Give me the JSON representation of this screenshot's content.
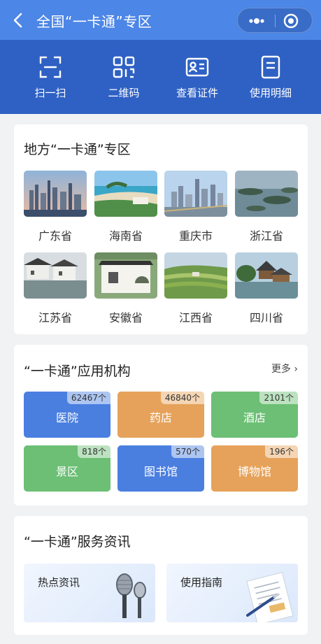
{
  "header": {
    "title": "全国“一卡通”专区"
  },
  "toolbar": {
    "items": [
      {
        "label": "扫一扫",
        "icon": "scan-icon"
      },
      {
        "label": "二维码",
        "icon": "qrcode-icon"
      },
      {
        "label": "查看证件",
        "icon": "id-card-icon"
      },
      {
        "label": "使用明细",
        "icon": "document-icon"
      }
    ]
  },
  "regions": {
    "title": "地方“一卡通”专区",
    "items": [
      {
        "name": "广东省"
      },
      {
        "name": "海南省"
      },
      {
        "name": "重庆市"
      },
      {
        "name": "浙江省"
      },
      {
        "name": "江苏省"
      },
      {
        "name": "安徽省"
      },
      {
        "name": "江西省"
      },
      {
        "name": "四川省"
      }
    ]
  },
  "institutions": {
    "title": "“一卡通”应用机构",
    "more": "更多 ›",
    "items": [
      {
        "name": "医院",
        "count": "62467个",
        "color": "#4a7fe0"
      },
      {
        "name": "药店",
        "count": "46840个",
        "color": "#e6a25a"
      },
      {
        "name": "酒店",
        "count": "2101个",
        "color": "#6cbf74"
      },
      {
        "name": "景区",
        "count": "818个",
        "color": "#6cbf74"
      },
      {
        "name": "图书馆",
        "count": "570个",
        "color": "#4a7fe0"
      },
      {
        "name": "博物馆",
        "count": "196个",
        "color": "#e6a25a"
      }
    ]
  },
  "news": {
    "title": "“一卡通”服务资讯",
    "items": [
      {
        "label": "热点资讯",
        "icon": "microphone-icon"
      },
      {
        "label": "使用指南",
        "icon": "document-pen-icon"
      }
    ]
  }
}
